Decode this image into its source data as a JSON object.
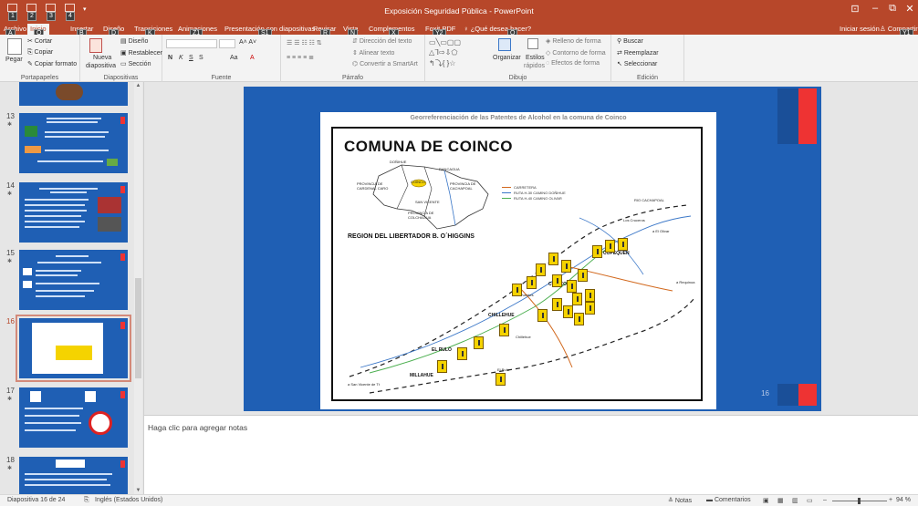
{
  "title": "Exposición Seguridad Pública - PowerPoint",
  "qat_keytips": [
    "1",
    "2",
    "3",
    "4"
  ],
  "window": {
    "minimize": "–",
    "restore": "⧉",
    "close": "✕",
    "ribbon_display": "⊡"
  },
  "tabs": [
    {
      "label": "Archivo",
      "keytip": "A"
    },
    {
      "label": "Inicio",
      "keytip": "O",
      "active": true
    },
    {
      "label": "Insertar",
      "keytip": "B"
    },
    {
      "label": "Diseño",
      "keytip": "D"
    },
    {
      "label": "Transiciones",
      "keytip": "K"
    },
    {
      "label": "Animaciones",
      "keytip": "Z1"
    },
    {
      "label": "Presentación con diapositivas",
      "keytip": "S1"
    },
    {
      "label": "Revisar",
      "keytip": "R"
    },
    {
      "label": "Vista",
      "keytip": "N"
    },
    {
      "label": "Complementos",
      "keytip": "X"
    },
    {
      "label": "Foxit PDF",
      "keytip": "Y2"
    }
  ],
  "tell_me": "¿Qué desea hacer?",
  "tell_me_keytip": "Q",
  "account": {
    "signin": "Iniciar sesión",
    "share": "Compartir",
    "share_keytip": "Y1"
  },
  "ribbon": {
    "clipboard": {
      "paste": "Pegar",
      "cut": "Cortar",
      "copy": "Copiar",
      "format_painter": "Copiar formato",
      "label": "Portapapeles"
    },
    "slides": {
      "new_slide": "Nueva",
      "new_slide2": "diapositiva",
      "layout": "Diseño",
      "reset": "Restablecer",
      "section": "Sección",
      "label": "Diapositivas"
    },
    "font": {
      "bold": "N",
      "italic": "K",
      "underline": "S",
      "strike": "S",
      "case": "Aa",
      "label": "Fuente"
    },
    "paragraph": {
      "text_direction": "Dirección del texto",
      "align_text": "Alinear texto",
      "smartart": "Convertir a SmartArt",
      "label": "Párrafo"
    },
    "drawing": {
      "arrange": "Organizar",
      "styles": "Estilos",
      "quick": "rápidos",
      "fill": "Relleno de forma",
      "outline": "Contorno de forma",
      "effects": "Efectos de forma",
      "label": "Dibujo"
    },
    "editing": {
      "find": "Buscar",
      "replace": "Reemplazar",
      "select": "Seleccionar",
      "label": "Edición"
    }
  },
  "thumbnails": [
    {
      "num": "13",
      "selected": false
    },
    {
      "num": "14",
      "selected": false
    },
    {
      "num": "15",
      "selected": false
    },
    {
      "num": "16",
      "selected": true
    },
    {
      "num": "17",
      "selected": false
    },
    {
      "num": "18",
      "selected": false
    }
  ],
  "slide": {
    "page_number": "16",
    "map_title": "Georreferenciación de las Patentes de Alcohol en la comuna de Coinco",
    "comuna": "COMUNA DE COINCO",
    "region": "REGION DEL LIBERTADOR B. O´HIGGINS",
    "legend": [
      "CARRETERA",
      "RUTA H-30 CAMINO DOÑIHUE",
      "RUTA H-40 CAMINO OLIVAR"
    ],
    "legend_colors": [
      "#d2691e",
      "#3c78c8",
      "#4caf50"
    ],
    "inset_labels": [
      "DOÑIHUE",
      "RANCAGUA",
      "COINCO",
      "PROVINCIA DE CARDENAL CARO",
      "PROVINCIA DE CACHAPOAL",
      "PROVINCIA DE COLCHAGUA",
      "SAN VICENTE"
    ],
    "towns": [
      "COINCO",
      "COPEQUEN",
      "CHILLEHUE",
      "EL RULO",
      "MILLAHUE"
    ],
    "place_labels": [
      "a El Olivar",
      "a Requinoa",
      "a San Vicente de Tt",
      "Los Cruceros",
      "El Rulo",
      "Tres Puentes",
      "Chillehue"
    ],
    "river": "RIO CACHAPOAL"
  },
  "notes_placeholder": "Haga clic para agregar notas",
  "status": {
    "slide_count": "Diapositiva 16 de 24",
    "language": "Inglés (Estados Unidos)",
    "notes": "Notas",
    "comments": "Comentarios",
    "zoom": "94 %"
  }
}
